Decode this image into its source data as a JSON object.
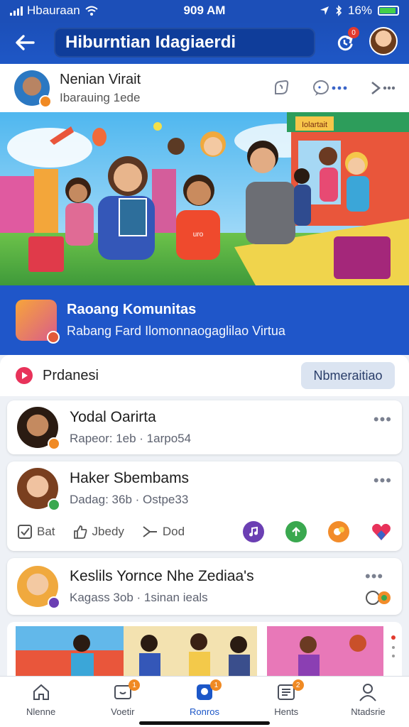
{
  "status": {
    "carrier": "Hbauraan",
    "time": "909 AM",
    "battery": "16%"
  },
  "appbar": {
    "title": "Hiburntian Idagiaerdi",
    "notif_count": "0"
  },
  "profile": {
    "name": "Nenian Virait",
    "subtitle": "Ibarauing 1ede"
  },
  "hero": {
    "banner_text": "Iolartait",
    "shirt_text": "uro"
  },
  "community": {
    "title": "Raoang Komunitas",
    "subtitle": "Rabang Fard Ilomonnaogaglilao Virtua"
  },
  "section": {
    "title": "Prdanesi",
    "button": "Nbmeraitiao"
  },
  "cards": [
    {
      "name": "Yodal Oarirta",
      "meta": "Rapeor: 1eb · 1arpo54"
    },
    {
      "name": "Haker Sbembams",
      "meta": "Dadag: 36b · Ostpe33",
      "actions": [
        {
          "label": "Bat",
          "icon": "checkbox-icon"
        },
        {
          "label": "Jbedy",
          "icon": "thumbs-up-icon"
        },
        {
          "label": "Dod",
          "icon": "share-icon"
        }
      ]
    },
    {
      "name": "Keslils Yornce Nhe Zediaa's",
      "meta": "Kagass 3ob · 1sinan ieals"
    }
  ],
  "nav": [
    {
      "label": "Nlenne",
      "icon": "home-icon",
      "badge": ""
    },
    {
      "label": "Voetir",
      "icon": "video-icon",
      "badge": "1"
    },
    {
      "label": "Ronros",
      "icon": "groups-icon",
      "badge": "1"
    },
    {
      "label": "Hents",
      "icon": "list-icon",
      "badge": "2"
    },
    {
      "label": "Ntadsrie",
      "icon": "profile-icon",
      "badge": ""
    }
  ],
  "colors": {
    "primary": "#1c4fb8",
    "accent": "#1f56c9",
    "badge": "#e23a2e"
  }
}
